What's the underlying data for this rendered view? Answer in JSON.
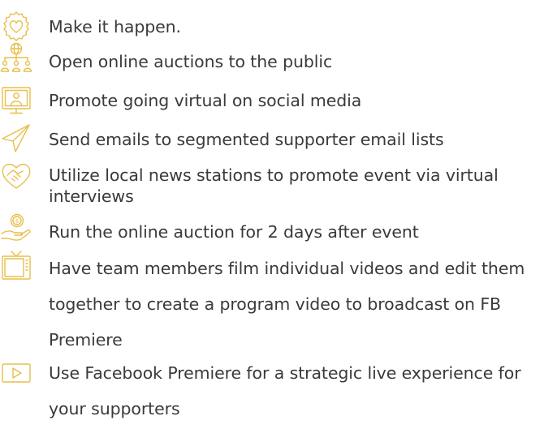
{
  "items": [
    {
      "icon": "heart-badge-icon",
      "text": "Make it happen."
    },
    {
      "icon": "globe-network-icon",
      "text": "Open online auctions to the public"
    },
    {
      "icon": "monitor-person-icon",
      "text": "Promote going virtual on social media"
    },
    {
      "icon": "paper-plane-icon",
      "text": "Send emails to segmented supporter email lists"
    },
    {
      "icon": "handshake-heart-icon",
      "text": "Utilize local news stations to promote event via virtual interviews"
    },
    {
      "icon": "coin-hand-icon",
      "text": "Run the online auction for 2 days after event"
    },
    {
      "icon": "television-icon",
      "text": "Have team members film individual videos and edit them together to create a program video to broadcast on FB Premiere"
    },
    {
      "icon": "play-button-icon",
      "text": "Use Facebook Premiere for a strategic live experience for your supporters"
    }
  ],
  "colors": {
    "icon": "#e7bf4a",
    "text": "#3a3a3a"
  }
}
